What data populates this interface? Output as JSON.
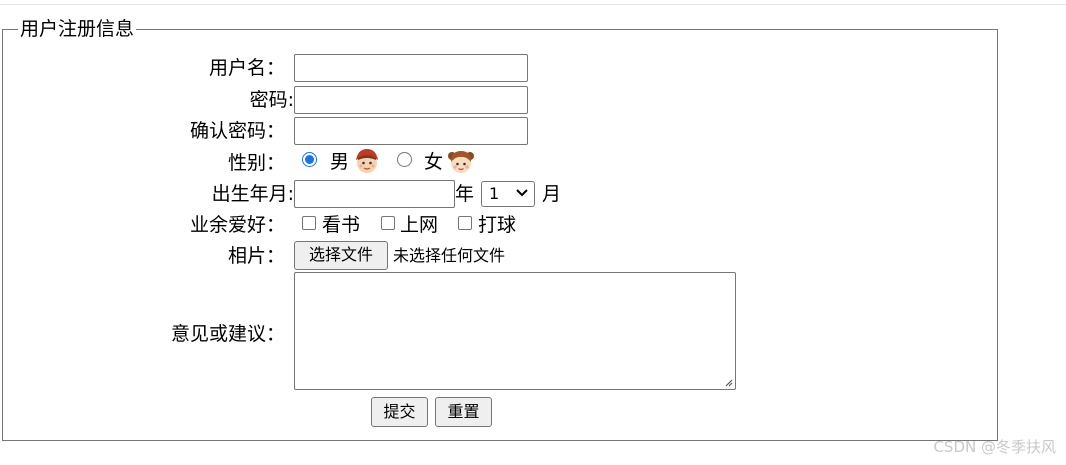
{
  "form": {
    "legend": "用户注册信息",
    "username_label": "用户名：",
    "password_label": "密码:",
    "confirm_label": "确认密码：",
    "gender_label": "性别：",
    "gender_male": "男",
    "gender_female": "女",
    "birth_label": "出生年月:",
    "year_unit": "年",
    "month_unit": "月",
    "month_selected": "1",
    "hobby_label": "业余爱好：",
    "hobby_reading": "看书",
    "hobby_internet": "上网",
    "hobby_ball": "打球",
    "photo_label": "相片：",
    "choose_file": "选择文件",
    "no_file": "未选择任何文件",
    "comments_label": "意见或建议：",
    "submit": "提交",
    "reset": "重置"
  },
  "watermark": "CSDN @冬季扶风",
  "colors": {
    "radio_accent": "#1a73e8",
    "border": "#767676",
    "button_bg": "#efefef"
  },
  "icons": {
    "male": "boy-avatar-icon",
    "female": "girl-avatar-icon"
  }
}
